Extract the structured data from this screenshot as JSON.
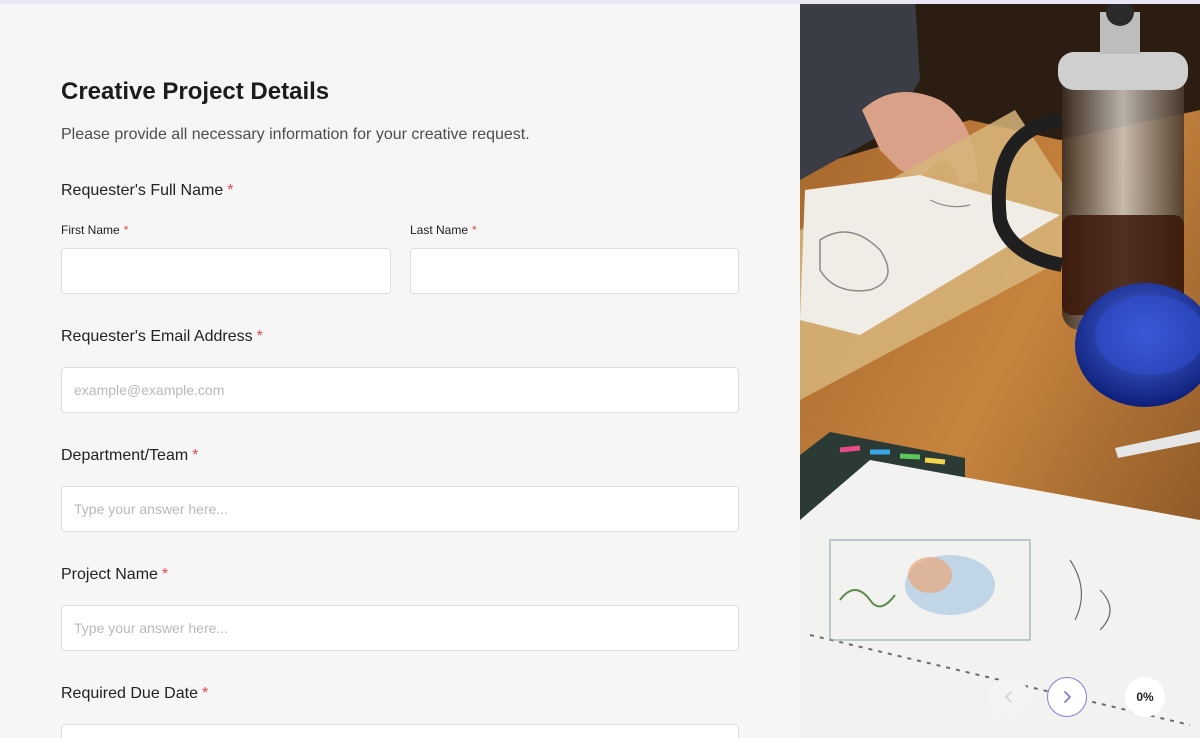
{
  "form": {
    "title": "Creative Project Details",
    "subtitle": "Please provide all necessary information for your creative request.",
    "required_marker": "*",
    "full_name": {
      "label": "Requester's Full Name",
      "first_name_label": "First Name",
      "first_name_value": "",
      "last_name_label": "Last Name",
      "last_name_value": ""
    },
    "email": {
      "label": "Requester's Email Address",
      "placeholder": "example@example.com",
      "value": ""
    },
    "department": {
      "label": "Department/Team",
      "placeholder": "Type your answer here...",
      "value": ""
    },
    "project_name": {
      "label": "Project Name",
      "placeholder": "Type your answer here...",
      "value": ""
    },
    "due_date": {
      "label": "Required Due Date",
      "value": ""
    }
  },
  "navigation": {
    "prev_icon": "chevron-left-icon",
    "next_icon": "chevron-right-icon",
    "progress_percent": 0,
    "progress_text": "0%",
    "accent_color": "#8b79d6"
  },
  "colors": {
    "required": "#e5484d",
    "background": "#f6f6f6"
  },
  "side_image": {
    "icon": "photo-icon"
  }
}
